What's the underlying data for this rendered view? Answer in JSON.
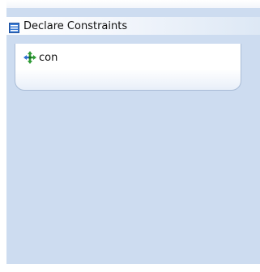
{
  "panel": {
    "title": "Declare Constraints",
    "title_icon": "list-panel-icon"
  },
  "constraints": [
    {
      "label": "con",
      "icon": "constraint-arrows-icon"
    }
  ],
  "colors": {
    "panel_background": "#cddcf0",
    "card_border": "#a9bcd6",
    "icon_green": "#2e9a35",
    "icon_blue": "#2f6fd1"
  }
}
